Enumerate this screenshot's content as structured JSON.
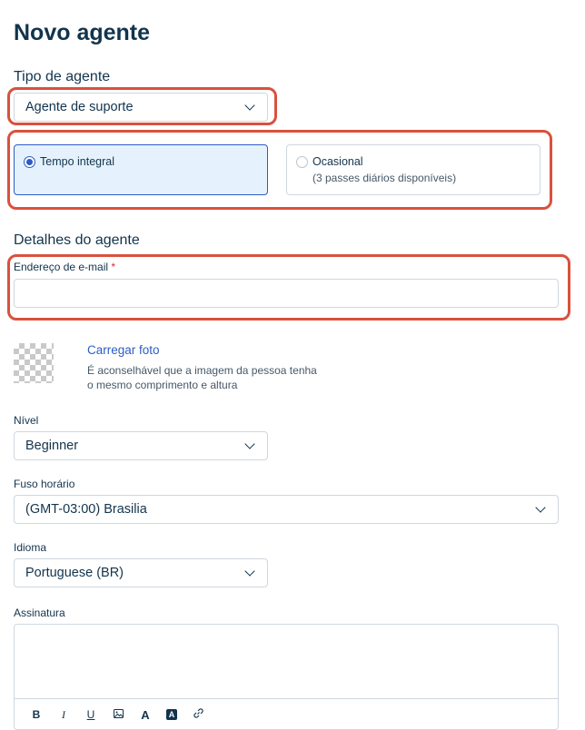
{
  "page": {
    "title": "Novo agente"
  },
  "agent_type": {
    "heading": "Tipo de agente",
    "selected": "Agente de suporte",
    "options": [
      {
        "label": "Tempo integral",
        "sub": "",
        "selected": true
      },
      {
        "label": "Ocasional",
        "sub": "(3 passes diários disponíveis)",
        "selected": false
      }
    ]
  },
  "details": {
    "heading": "Detalhes do agente",
    "email": {
      "label": "Endereço de e-mail",
      "required_mark": "*",
      "value": ""
    }
  },
  "photo": {
    "link": "Carregar foto",
    "hint_line1": "É aconselhável que a imagem da pessoa tenha",
    "hint_line2": "o mesmo comprimento e altura"
  },
  "level": {
    "label": "Nível",
    "value": "Beginner"
  },
  "timezone": {
    "label": "Fuso horário",
    "value": "(GMT-03:00) Brasilia"
  },
  "language": {
    "label": "Idioma",
    "value": "Portuguese (BR)"
  },
  "signature": {
    "label": "Assinatura",
    "toolbar": [
      "B",
      "I",
      "U",
      "image-icon",
      "A",
      "A",
      "link-icon"
    ]
  },
  "colors": {
    "accent": "#2c5cc5",
    "highlight": "#d9513e",
    "selected_bg": "#e5f2fd",
    "required": "#d72d30"
  }
}
